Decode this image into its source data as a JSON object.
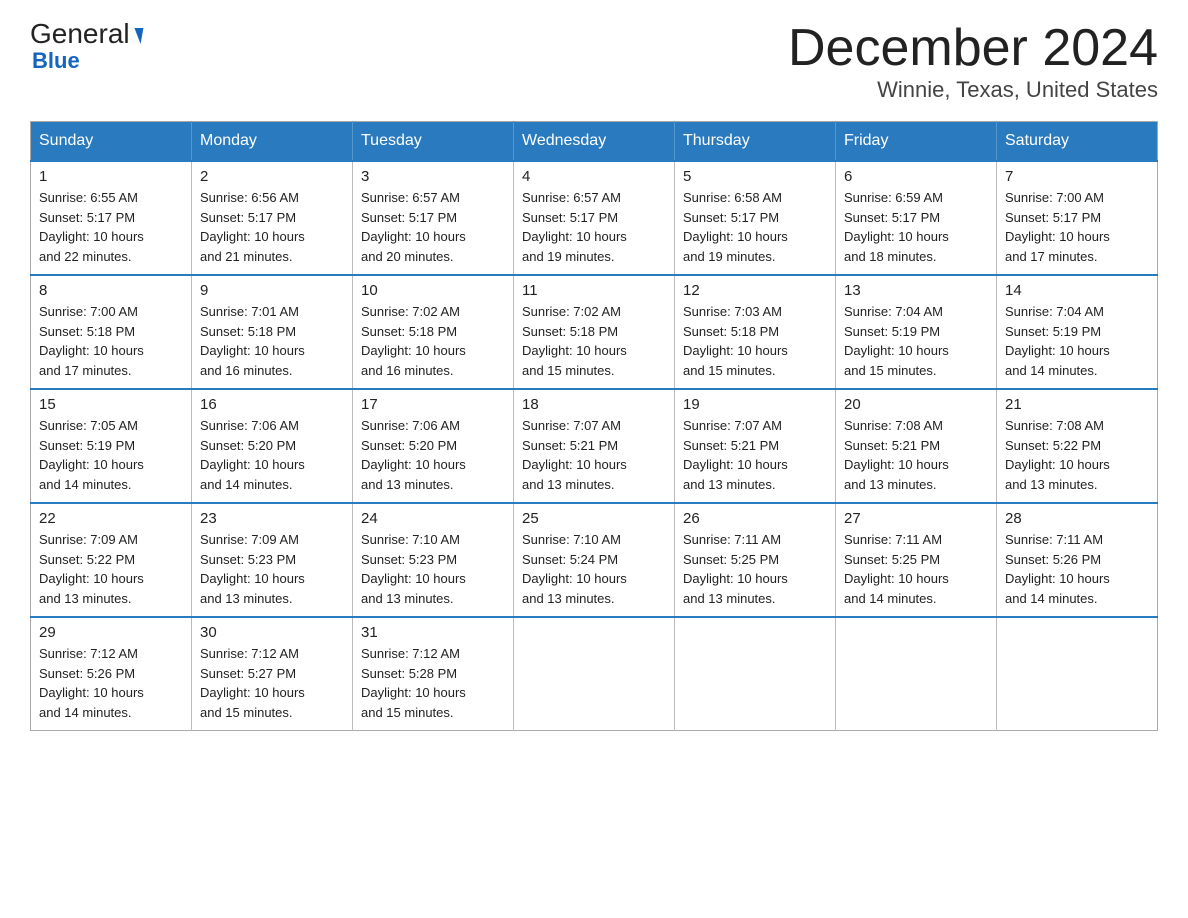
{
  "logo": {
    "part1": "General",
    "part2": "Blue"
  },
  "title": "December 2024",
  "subtitle": "Winnie, Texas, United States",
  "days_of_week": [
    "Sunday",
    "Monday",
    "Tuesday",
    "Wednesday",
    "Thursday",
    "Friday",
    "Saturday"
  ],
  "weeks": [
    [
      {
        "day": "1",
        "sunrise": "6:55 AM",
        "sunset": "5:17 PM",
        "daylight": "10 hours and 22 minutes."
      },
      {
        "day": "2",
        "sunrise": "6:56 AM",
        "sunset": "5:17 PM",
        "daylight": "10 hours and 21 minutes."
      },
      {
        "day": "3",
        "sunrise": "6:57 AM",
        "sunset": "5:17 PM",
        "daylight": "10 hours and 20 minutes."
      },
      {
        "day": "4",
        "sunrise": "6:57 AM",
        "sunset": "5:17 PM",
        "daylight": "10 hours and 19 minutes."
      },
      {
        "day": "5",
        "sunrise": "6:58 AM",
        "sunset": "5:17 PM",
        "daylight": "10 hours and 19 minutes."
      },
      {
        "day": "6",
        "sunrise": "6:59 AM",
        "sunset": "5:17 PM",
        "daylight": "10 hours and 18 minutes."
      },
      {
        "day": "7",
        "sunrise": "7:00 AM",
        "sunset": "5:17 PM",
        "daylight": "10 hours and 17 minutes."
      }
    ],
    [
      {
        "day": "8",
        "sunrise": "7:00 AM",
        "sunset": "5:18 PM",
        "daylight": "10 hours and 17 minutes."
      },
      {
        "day": "9",
        "sunrise": "7:01 AM",
        "sunset": "5:18 PM",
        "daylight": "10 hours and 16 minutes."
      },
      {
        "day": "10",
        "sunrise": "7:02 AM",
        "sunset": "5:18 PM",
        "daylight": "10 hours and 16 minutes."
      },
      {
        "day": "11",
        "sunrise": "7:02 AM",
        "sunset": "5:18 PM",
        "daylight": "10 hours and 15 minutes."
      },
      {
        "day": "12",
        "sunrise": "7:03 AM",
        "sunset": "5:18 PM",
        "daylight": "10 hours and 15 minutes."
      },
      {
        "day": "13",
        "sunrise": "7:04 AM",
        "sunset": "5:19 PM",
        "daylight": "10 hours and 15 minutes."
      },
      {
        "day": "14",
        "sunrise": "7:04 AM",
        "sunset": "5:19 PM",
        "daylight": "10 hours and 14 minutes."
      }
    ],
    [
      {
        "day": "15",
        "sunrise": "7:05 AM",
        "sunset": "5:19 PM",
        "daylight": "10 hours and 14 minutes."
      },
      {
        "day": "16",
        "sunrise": "7:06 AM",
        "sunset": "5:20 PM",
        "daylight": "10 hours and 14 minutes."
      },
      {
        "day": "17",
        "sunrise": "7:06 AM",
        "sunset": "5:20 PM",
        "daylight": "10 hours and 13 minutes."
      },
      {
        "day": "18",
        "sunrise": "7:07 AM",
        "sunset": "5:21 PM",
        "daylight": "10 hours and 13 minutes."
      },
      {
        "day": "19",
        "sunrise": "7:07 AM",
        "sunset": "5:21 PM",
        "daylight": "10 hours and 13 minutes."
      },
      {
        "day": "20",
        "sunrise": "7:08 AM",
        "sunset": "5:21 PM",
        "daylight": "10 hours and 13 minutes."
      },
      {
        "day": "21",
        "sunrise": "7:08 AM",
        "sunset": "5:22 PM",
        "daylight": "10 hours and 13 minutes."
      }
    ],
    [
      {
        "day": "22",
        "sunrise": "7:09 AM",
        "sunset": "5:22 PM",
        "daylight": "10 hours and 13 minutes."
      },
      {
        "day": "23",
        "sunrise": "7:09 AM",
        "sunset": "5:23 PM",
        "daylight": "10 hours and 13 minutes."
      },
      {
        "day": "24",
        "sunrise": "7:10 AM",
        "sunset": "5:23 PM",
        "daylight": "10 hours and 13 minutes."
      },
      {
        "day": "25",
        "sunrise": "7:10 AM",
        "sunset": "5:24 PM",
        "daylight": "10 hours and 13 minutes."
      },
      {
        "day": "26",
        "sunrise": "7:11 AM",
        "sunset": "5:25 PM",
        "daylight": "10 hours and 13 minutes."
      },
      {
        "day": "27",
        "sunrise": "7:11 AM",
        "sunset": "5:25 PM",
        "daylight": "10 hours and 14 minutes."
      },
      {
        "day": "28",
        "sunrise": "7:11 AM",
        "sunset": "5:26 PM",
        "daylight": "10 hours and 14 minutes."
      }
    ],
    [
      {
        "day": "29",
        "sunrise": "7:12 AM",
        "sunset": "5:26 PM",
        "daylight": "10 hours and 14 minutes."
      },
      {
        "day": "30",
        "sunrise": "7:12 AM",
        "sunset": "5:27 PM",
        "daylight": "10 hours and 15 minutes."
      },
      {
        "day": "31",
        "sunrise": "7:12 AM",
        "sunset": "5:28 PM",
        "daylight": "10 hours and 15 minutes."
      },
      null,
      null,
      null,
      null
    ]
  ],
  "labels": {
    "sunrise": "Sunrise:",
    "sunset": "Sunset:",
    "daylight": "Daylight:"
  }
}
